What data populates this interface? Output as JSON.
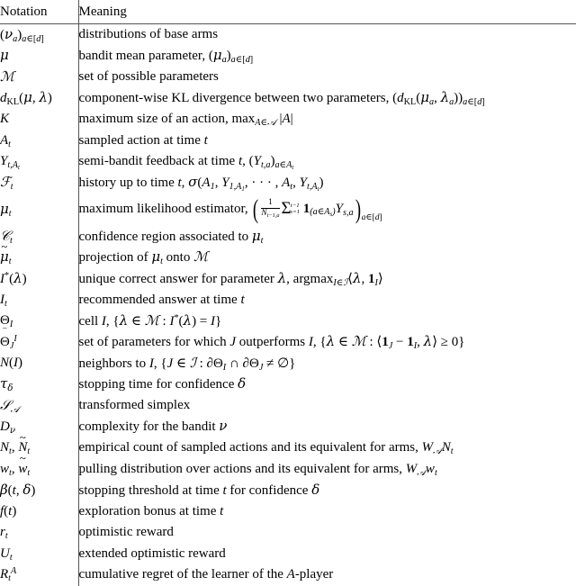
{
  "table": {
    "headers": {
      "notation": "Notation",
      "meaning": "Meaning"
    },
    "rows": [
      {
        "notation_text": "(νa)a∈[d]",
        "meaning_text": "distributions of base arms"
      },
      {
        "notation_text": "μ",
        "meaning_text": "bandit mean parameter, (μa)a∈[d]"
      },
      {
        "notation_text": "M",
        "meaning_text": "set of possible parameters"
      },
      {
        "notation_text": "dKL(μ, λ)",
        "meaning_text": "component-wise KL divergence between two parameters, (dKL(μa, λa))a∈[d]"
      },
      {
        "notation_text": "K",
        "meaning_text": "maximum size of an action, maxA∈A |A|"
      },
      {
        "notation_text": "At",
        "meaning_text": "sampled action at time t"
      },
      {
        "notation_text": "Yt,At",
        "meaning_text": "semi-bandit feedback at time t, (Yt,a)a∈At"
      },
      {
        "notation_text": "Ft",
        "meaning_text": "history up to time t, σ(A1, Y1,A1, · · · , At, Yt,At)"
      },
      {
        "notation_text": "μt",
        "meaning_text": "maximum likelihood estimator, ( 1/Nt−1,a Σs=1..t−1 1(a∈As) Ys,a )a∈[d]"
      },
      {
        "notation_text": "Ct",
        "meaning_text": "confidence region associated to μt"
      },
      {
        "notation_text": "μ̃t",
        "meaning_text": "projection of μt onto M"
      },
      {
        "notation_text": "I*(λ)",
        "meaning_text": "unique correct answer for parameter λ, argmaxI∈I ⟨λ, 1I⟩"
      },
      {
        "notation_text": "It",
        "meaning_text": "recommended answer at time t"
      },
      {
        "notation_text": "ΘI",
        "meaning_text": "cell I, {λ ∈ M : I*(λ) = I}"
      },
      {
        "notation_text": "Θ̄IJ",
        "meaning_text": "set of parameters for which J outperforms I, {λ ∈ M : ⟨1J − 1I, λ⟩ ≥ 0}"
      },
      {
        "notation_text": "N(I)",
        "meaning_text": "neighbors to I, {J ∈ I : ∂ΘI ∩ ∂ΘJ ≠ ∅}"
      },
      {
        "notation_text": "τδ",
        "meaning_text": "stopping time for confidence δ"
      },
      {
        "notation_text": "SA",
        "meaning_text": "transformed simplex"
      },
      {
        "notation_text": "Dν",
        "meaning_text": "complexity for the bandit ν"
      },
      {
        "notation_text": "Nt, Ñt",
        "meaning_text": "empirical count of sampled actions and its equivalent for arms, WANt"
      },
      {
        "notation_text": "wt, w̃t",
        "meaning_text": "pulling distribution over actions and its equivalent for arms, WAwt"
      },
      {
        "notation_text": "β(t, δ)",
        "meaning_text": "stopping threshold at time t for confidence δ"
      },
      {
        "notation_text": "f(t)",
        "meaning_text": "exploration bonus at time t"
      },
      {
        "notation_text": "rt",
        "meaning_text": "optimistic reward"
      },
      {
        "notation_text": "Ut",
        "meaning_text": "extended optimistic reward"
      },
      {
        "notation_text": "RAt",
        "meaning_text": "cumulative regret of the learner of the A-player"
      }
    ]
  },
  "style": {
    "rule_color": "#555555",
    "text_color": "#000000",
    "background": "#ffffff"
  }
}
